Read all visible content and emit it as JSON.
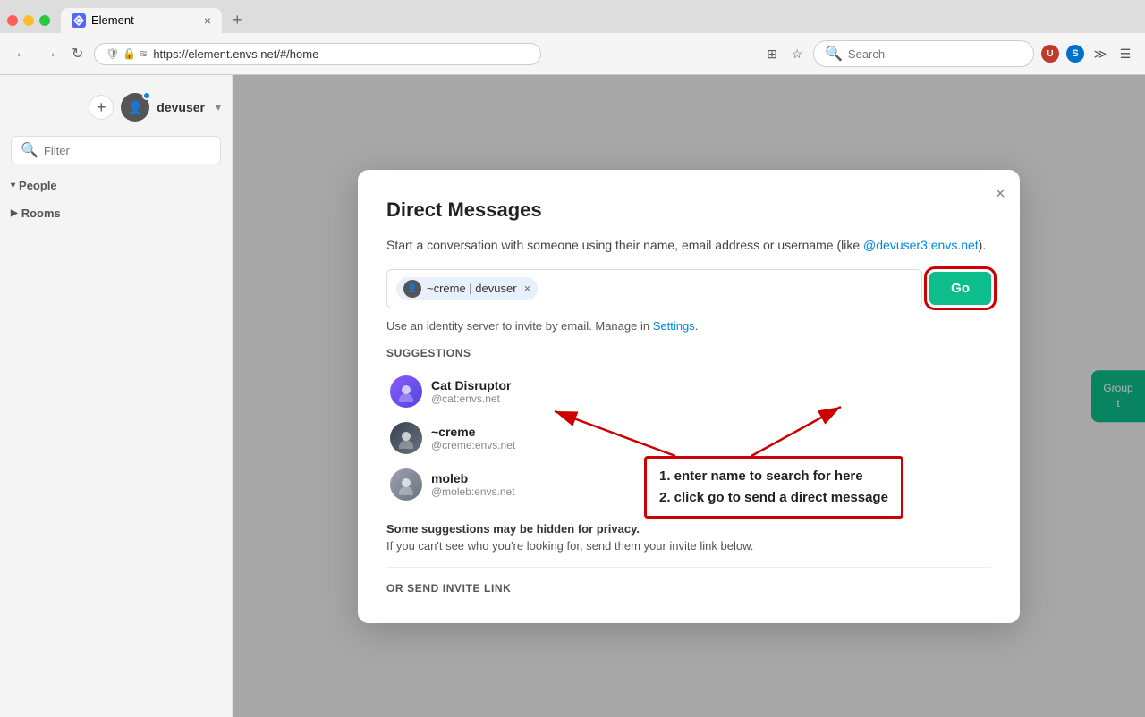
{
  "browser": {
    "tab_title": "Element",
    "tab_favicon": "E",
    "url": "https://element.envs.net/#/home",
    "new_tab_label": "+",
    "search_placeholder": "Search"
  },
  "sidebar": {
    "username": "devuser",
    "add_btn_label": "+",
    "filter_placeholder": "Filter",
    "people_label": "People",
    "rooms_label": "Rooms"
  },
  "dialog": {
    "title": "Direct Messages",
    "description_text": "Start a conversation with someone using their name, email address or username (like ",
    "description_link": "@devuser3:envs.net",
    "description_suffix": ").",
    "chip_label": "~creme | devuser",
    "go_button": "Go",
    "identity_text": "Use an identity server to invite by email. Manage in ",
    "settings_link": "Settings",
    "suggestions_label": "SUGGESTIONS",
    "suggestions": [
      {
        "name": "Cat Disruptor",
        "id": "@cat:envs.net",
        "avatar_type": "cat"
      },
      {
        "name": "~creme",
        "id": "@creme:envs.net",
        "avatar_type": "creme"
      },
      {
        "name": "moleb",
        "id": "@moleb:envs.net",
        "avatar_type": "moleb"
      }
    ],
    "privacy_bold": "Some suggestions may be hidden for privacy.",
    "privacy_text": "If you can't see who you're looking for, send them your invite link below.",
    "or_send_invite": "OR SEND INVITE LINK",
    "close_label": "×"
  },
  "right_panel": {
    "label": "Group\nt"
  },
  "annotation": {
    "line1": "1. enter name to search for here",
    "line2": "2. click go to send a direct message"
  }
}
